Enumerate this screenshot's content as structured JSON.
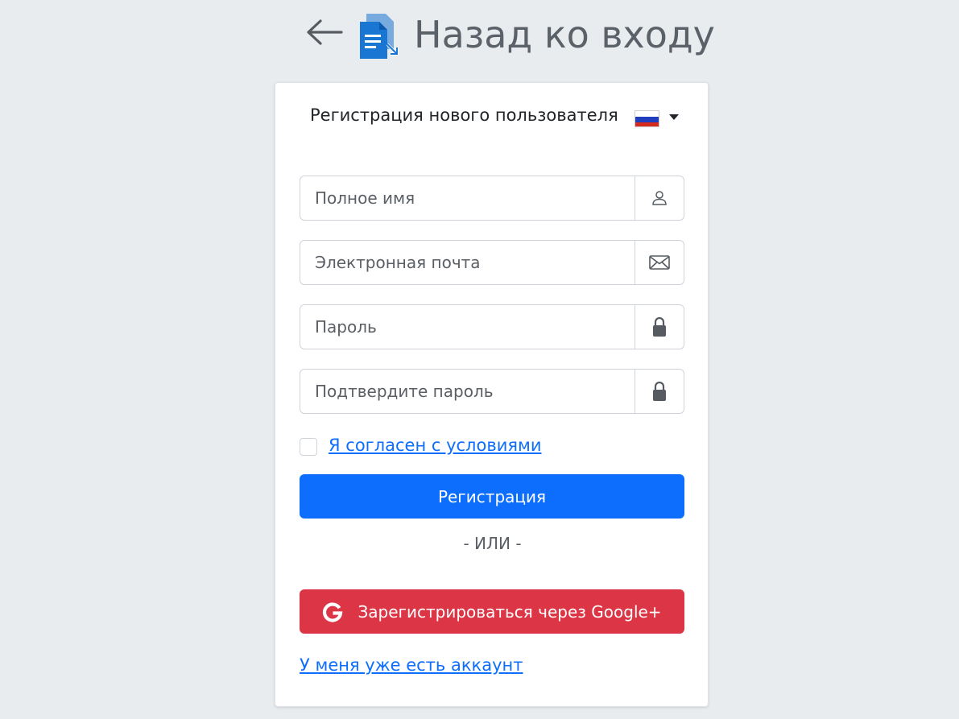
{
  "header": {
    "back_title": "Назад ко входу"
  },
  "card": {
    "title": "Регистрация нового пользователя",
    "language": {
      "selected": "Русский",
      "flag_icon": "russia-flag-icon"
    }
  },
  "form": {
    "full_name": {
      "placeholder": "Полное имя",
      "value": "",
      "icon": "user-icon"
    },
    "email": {
      "placeholder": "Электронная почта",
      "value": "",
      "icon": "envelope-icon"
    },
    "password": {
      "placeholder": "Пароль",
      "value": "",
      "icon": "lock-icon"
    },
    "confirm_password": {
      "placeholder": "Подтвердите пароль",
      "value": "",
      "icon": "lock-icon"
    },
    "terms_label": "Я согласен с условиями",
    "terms_checked": false,
    "register_label": "Регистрация",
    "or_label": "- ИЛИ -",
    "google_label": "Зарегистрироваться через Google+",
    "have_account_label": "У меня уже есть аккаунт"
  },
  "colors": {
    "background": "#e9ecef",
    "primary": "#0d6efd",
    "danger": "#dc3545",
    "logo_blue": "#1976d2"
  }
}
